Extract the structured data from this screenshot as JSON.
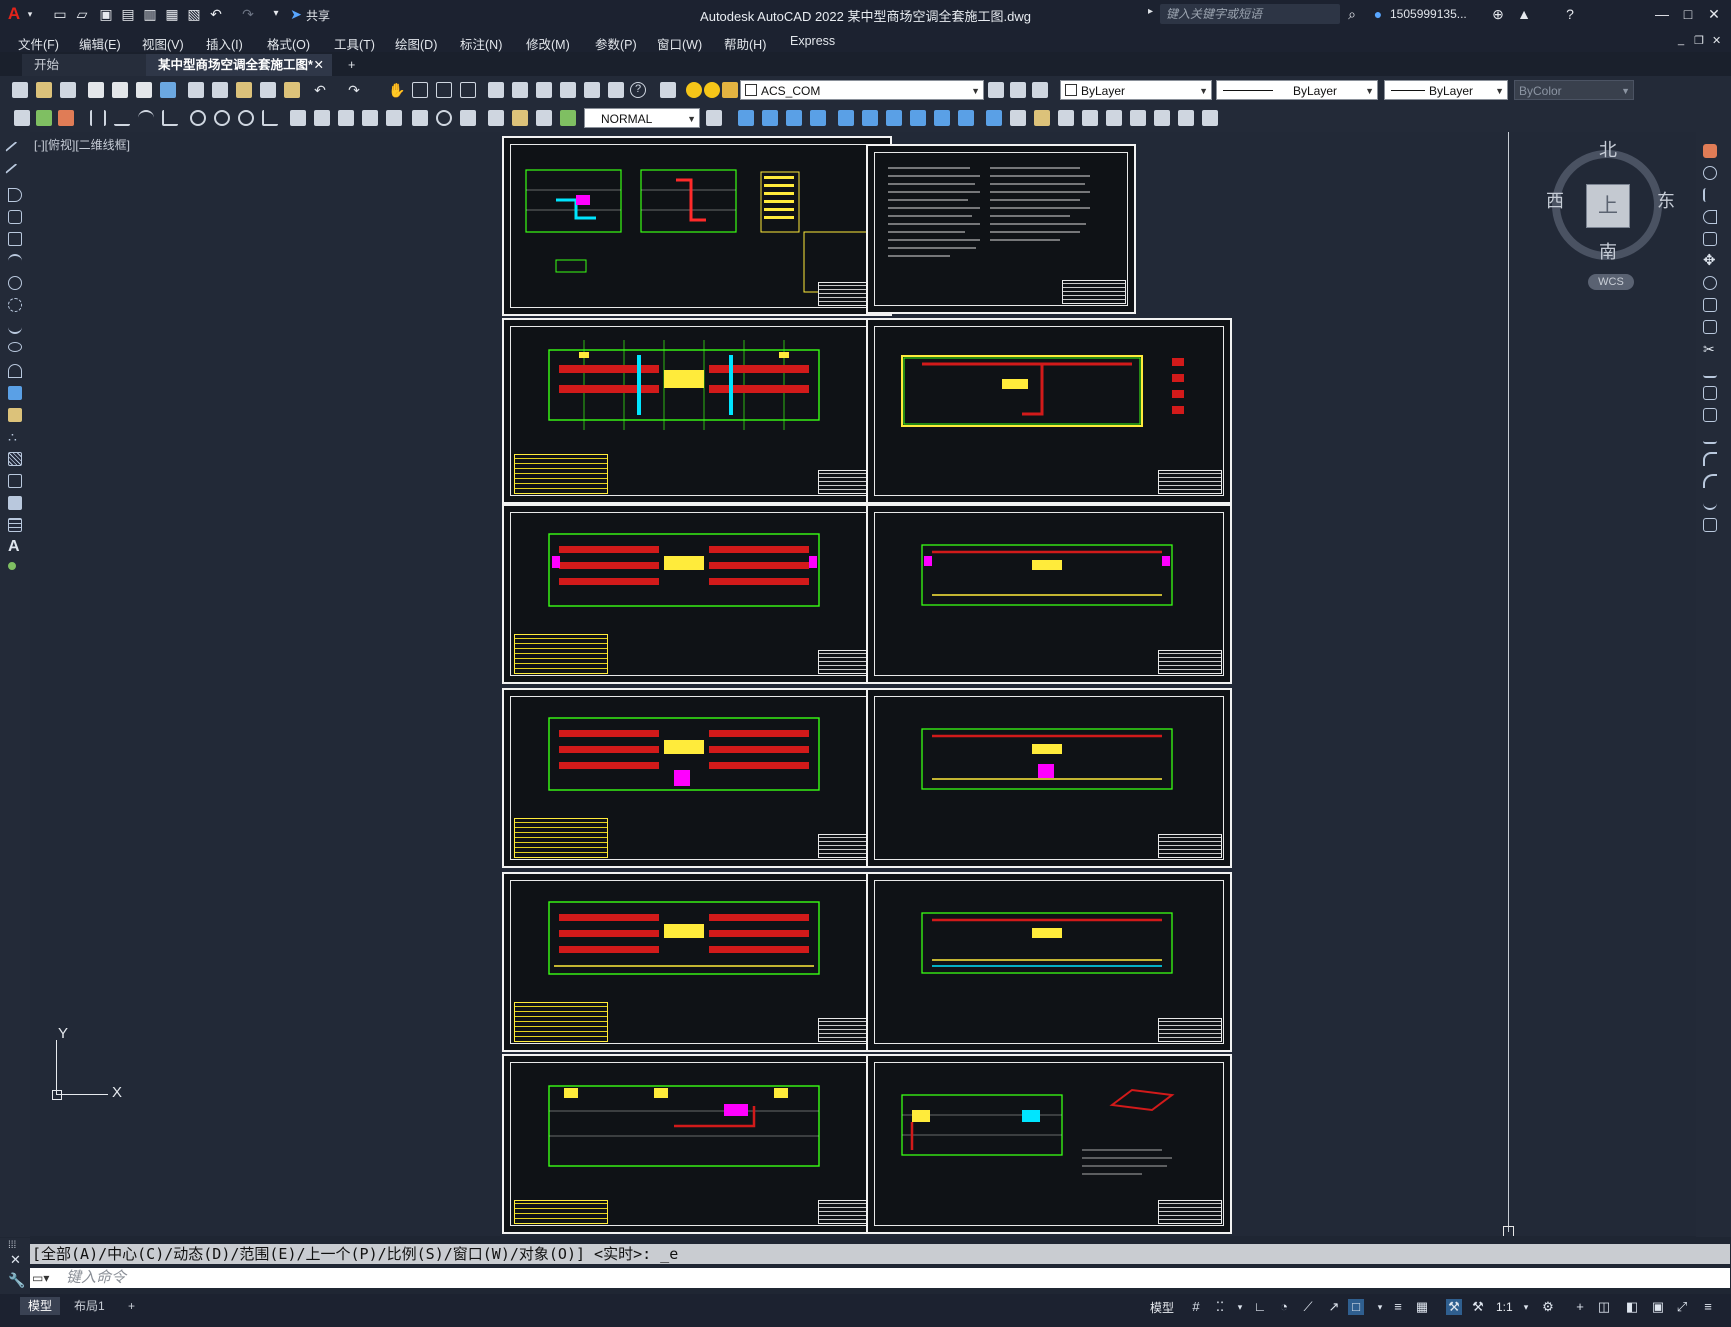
{
  "app": {
    "title": "Autodesk AutoCAD 2022    某中型商场空调全套施工图.dwg",
    "share_label": "共享",
    "search_placeholder": "键入关键字或短语",
    "user": "1505999135...",
    "colors": {
      "accent": "#e2231a",
      "titlebar": "#1c2230",
      "canvas": "#222937"
    }
  },
  "menus": [
    "文件(F)",
    "编辑(E)",
    "视图(V)",
    "插入(I)",
    "格式(O)",
    "工具(T)",
    "绘图(D)",
    "标注(N)",
    "修改(M)",
    "参数(P)",
    "窗口(W)",
    "帮助(H)",
    "Express"
  ],
  "tabs": [
    {
      "label": "开始",
      "active": false
    },
    {
      "label": "某中型商场空调全套施工图*",
      "active": true
    }
  ],
  "toolbar": {
    "layer": "ACS_COM",
    "color": "ByLayer",
    "linetype": "ByLayer",
    "lineweight": "ByLayer",
    "plotstyle": "ByColor",
    "textstyle": "NORMAL"
  },
  "viewport": {
    "label": "[-][俯视][二维线框]",
    "viewcube": {
      "north": "北",
      "south": "南",
      "east": "东",
      "west": "西",
      "face": "上",
      "wcs": "WCS"
    },
    "ucs": {
      "x": "X",
      "y": "Y"
    }
  },
  "command": {
    "history": "[全部(A)/中心(C)/动态(D)/范围(E)/上一个(P)/比例(S)/窗口(W)/对象(O)] <实时>: _e",
    "placeholder": "键入命令"
  },
  "status": {
    "model_tab": "模型",
    "layout_tab": "布局1",
    "model_label": "模型",
    "scale": "1:1"
  }
}
